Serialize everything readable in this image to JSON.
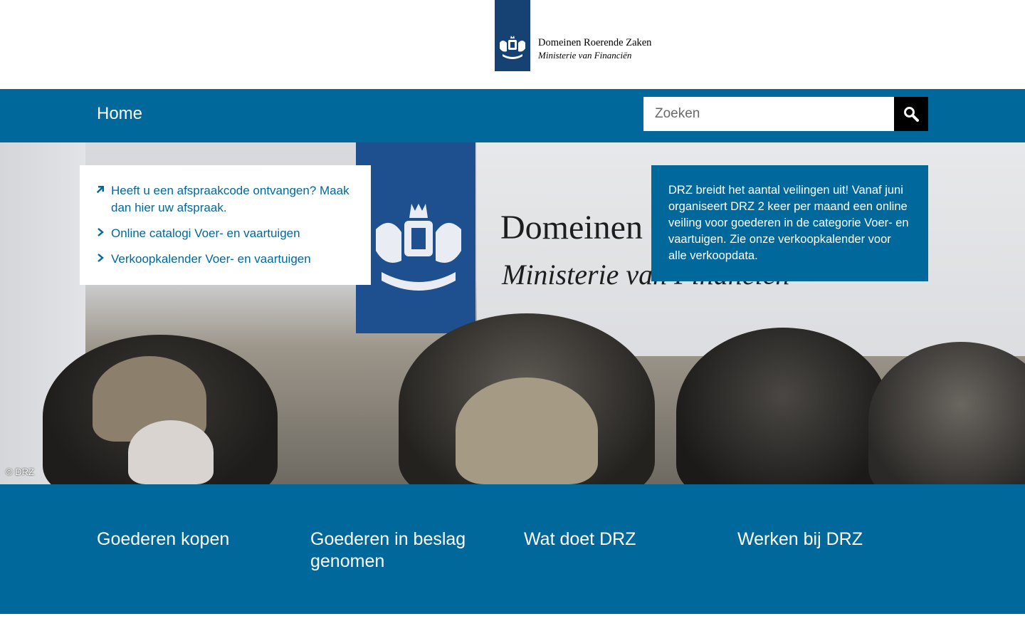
{
  "header": {
    "org_name": "Domeinen Roerende Zaken",
    "ministry": "Ministerie van Financiën"
  },
  "nav": {
    "home_label": "Home",
    "search_placeholder": "Zoeken"
  },
  "hero": {
    "banner_title": "Domeinen",
    "banner_subtitle": "Ministerie van Financiën",
    "photo_credit": "© DRZ"
  },
  "quick_links": [
    {
      "label": "Heeft u een afspraakcode ontvangen? Maak dan hier uw afspraak.",
      "icon": "external-arrow-icon"
    },
    {
      "label": "Online catalogi Voer- en vaartuigen",
      "icon": "chevron-right-icon"
    },
    {
      "label": "Verkoopkalender Voer- en vaartuigen",
      "icon": "chevron-right-icon"
    }
  ],
  "notice": {
    "text": "DRZ breidt het aantal veilingen uit! Vanaf juni organiseert DRZ 2 keer per maand een online veiling voor goederen in de categorie Voer- en vaartuigen. Zie onze verkoopkalender voor alle verkoopdata."
  },
  "footer_tiles": [
    {
      "label": "Goederen kopen"
    },
    {
      "label": "Goederen in beslag genomen"
    },
    {
      "label": "Wat doet DRZ"
    },
    {
      "label": "Werken bij DRZ"
    }
  ],
  "colors": {
    "brand_blue": "#01689b",
    "logo_blue": "#154273",
    "search_button": "#000000"
  }
}
